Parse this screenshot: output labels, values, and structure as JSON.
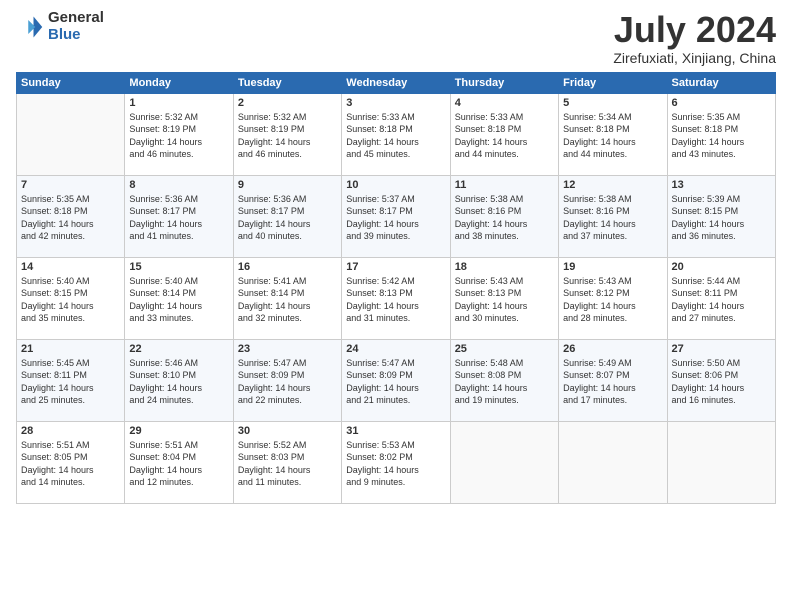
{
  "logo": {
    "general": "General",
    "blue": "Blue"
  },
  "title": "July 2024",
  "location": "Zirefuxiati, Xinjiang, China",
  "weekdays": [
    "Sunday",
    "Monday",
    "Tuesday",
    "Wednesday",
    "Thursday",
    "Friday",
    "Saturday"
  ],
  "weeks": [
    [
      {
        "day": "",
        "info": ""
      },
      {
        "day": "1",
        "info": "Sunrise: 5:32 AM\nSunset: 8:19 PM\nDaylight: 14 hours\nand 46 minutes."
      },
      {
        "day": "2",
        "info": "Sunrise: 5:32 AM\nSunset: 8:19 PM\nDaylight: 14 hours\nand 46 minutes."
      },
      {
        "day": "3",
        "info": "Sunrise: 5:33 AM\nSunset: 8:18 PM\nDaylight: 14 hours\nand 45 minutes."
      },
      {
        "day": "4",
        "info": "Sunrise: 5:33 AM\nSunset: 8:18 PM\nDaylight: 14 hours\nand 44 minutes."
      },
      {
        "day": "5",
        "info": "Sunrise: 5:34 AM\nSunset: 8:18 PM\nDaylight: 14 hours\nand 44 minutes."
      },
      {
        "day": "6",
        "info": "Sunrise: 5:35 AM\nSunset: 8:18 PM\nDaylight: 14 hours\nand 43 minutes."
      }
    ],
    [
      {
        "day": "7",
        "info": "Sunrise: 5:35 AM\nSunset: 8:18 PM\nDaylight: 14 hours\nand 42 minutes."
      },
      {
        "day": "8",
        "info": "Sunrise: 5:36 AM\nSunset: 8:17 PM\nDaylight: 14 hours\nand 41 minutes."
      },
      {
        "day": "9",
        "info": "Sunrise: 5:36 AM\nSunset: 8:17 PM\nDaylight: 14 hours\nand 40 minutes."
      },
      {
        "day": "10",
        "info": "Sunrise: 5:37 AM\nSunset: 8:17 PM\nDaylight: 14 hours\nand 39 minutes."
      },
      {
        "day": "11",
        "info": "Sunrise: 5:38 AM\nSunset: 8:16 PM\nDaylight: 14 hours\nand 38 minutes."
      },
      {
        "day": "12",
        "info": "Sunrise: 5:38 AM\nSunset: 8:16 PM\nDaylight: 14 hours\nand 37 minutes."
      },
      {
        "day": "13",
        "info": "Sunrise: 5:39 AM\nSunset: 8:15 PM\nDaylight: 14 hours\nand 36 minutes."
      }
    ],
    [
      {
        "day": "14",
        "info": "Sunrise: 5:40 AM\nSunset: 8:15 PM\nDaylight: 14 hours\nand 35 minutes."
      },
      {
        "day": "15",
        "info": "Sunrise: 5:40 AM\nSunset: 8:14 PM\nDaylight: 14 hours\nand 33 minutes."
      },
      {
        "day": "16",
        "info": "Sunrise: 5:41 AM\nSunset: 8:14 PM\nDaylight: 14 hours\nand 32 minutes."
      },
      {
        "day": "17",
        "info": "Sunrise: 5:42 AM\nSunset: 8:13 PM\nDaylight: 14 hours\nand 31 minutes."
      },
      {
        "day": "18",
        "info": "Sunrise: 5:43 AM\nSunset: 8:13 PM\nDaylight: 14 hours\nand 30 minutes."
      },
      {
        "day": "19",
        "info": "Sunrise: 5:43 AM\nSunset: 8:12 PM\nDaylight: 14 hours\nand 28 minutes."
      },
      {
        "day": "20",
        "info": "Sunrise: 5:44 AM\nSunset: 8:11 PM\nDaylight: 14 hours\nand 27 minutes."
      }
    ],
    [
      {
        "day": "21",
        "info": "Sunrise: 5:45 AM\nSunset: 8:11 PM\nDaylight: 14 hours\nand 25 minutes."
      },
      {
        "day": "22",
        "info": "Sunrise: 5:46 AM\nSunset: 8:10 PM\nDaylight: 14 hours\nand 24 minutes."
      },
      {
        "day": "23",
        "info": "Sunrise: 5:47 AM\nSunset: 8:09 PM\nDaylight: 14 hours\nand 22 minutes."
      },
      {
        "day": "24",
        "info": "Sunrise: 5:47 AM\nSunset: 8:09 PM\nDaylight: 14 hours\nand 21 minutes."
      },
      {
        "day": "25",
        "info": "Sunrise: 5:48 AM\nSunset: 8:08 PM\nDaylight: 14 hours\nand 19 minutes."
      },
      {
        "day": "26",
        "info": "Sunrise: 5:49 AM\nSunset: 8:07 PM\nDaylight: 14 hours\nand 17 minutes."
      },
      {
        "day": "27",
        "info": "Sunrise: 5:50 AM\nSunset: 8:06 PM\nDaylight: 14 hours\nand 16 minutes."
      }
    ],
    [
      {
        "day": "28",
        "info": "Sunrise: 5:51 AM\nSunset: 8:05 PM\nDaylight: 14 hours\nand 14 minutes."
      },
      {
        "day": "29",
        "info": "Sunrise: 5:51 AM\nSunset: 8:04 PM\nDaylight: 14 hours\nand 12 minutes."
      },
      {
        "day": "30",
        "info": "Sunrise: 5:52 AM\nSunset: 8:03 PM\nDaylight: 14 hours\nand 11 minutes."
      },
      {
        "day": "31",
        "info": "Sunrise: 5:53 AM\nSunset: 8:02 PM\nDaylight: 14 hours\nand 9 minutes."
      },
      {
        "day": "",
        "info": ""
      },
      {
        "day": "",
        "info": ""
      },
      {
        "day": "",
        "info": ""
      }
    ]
  ]
}
